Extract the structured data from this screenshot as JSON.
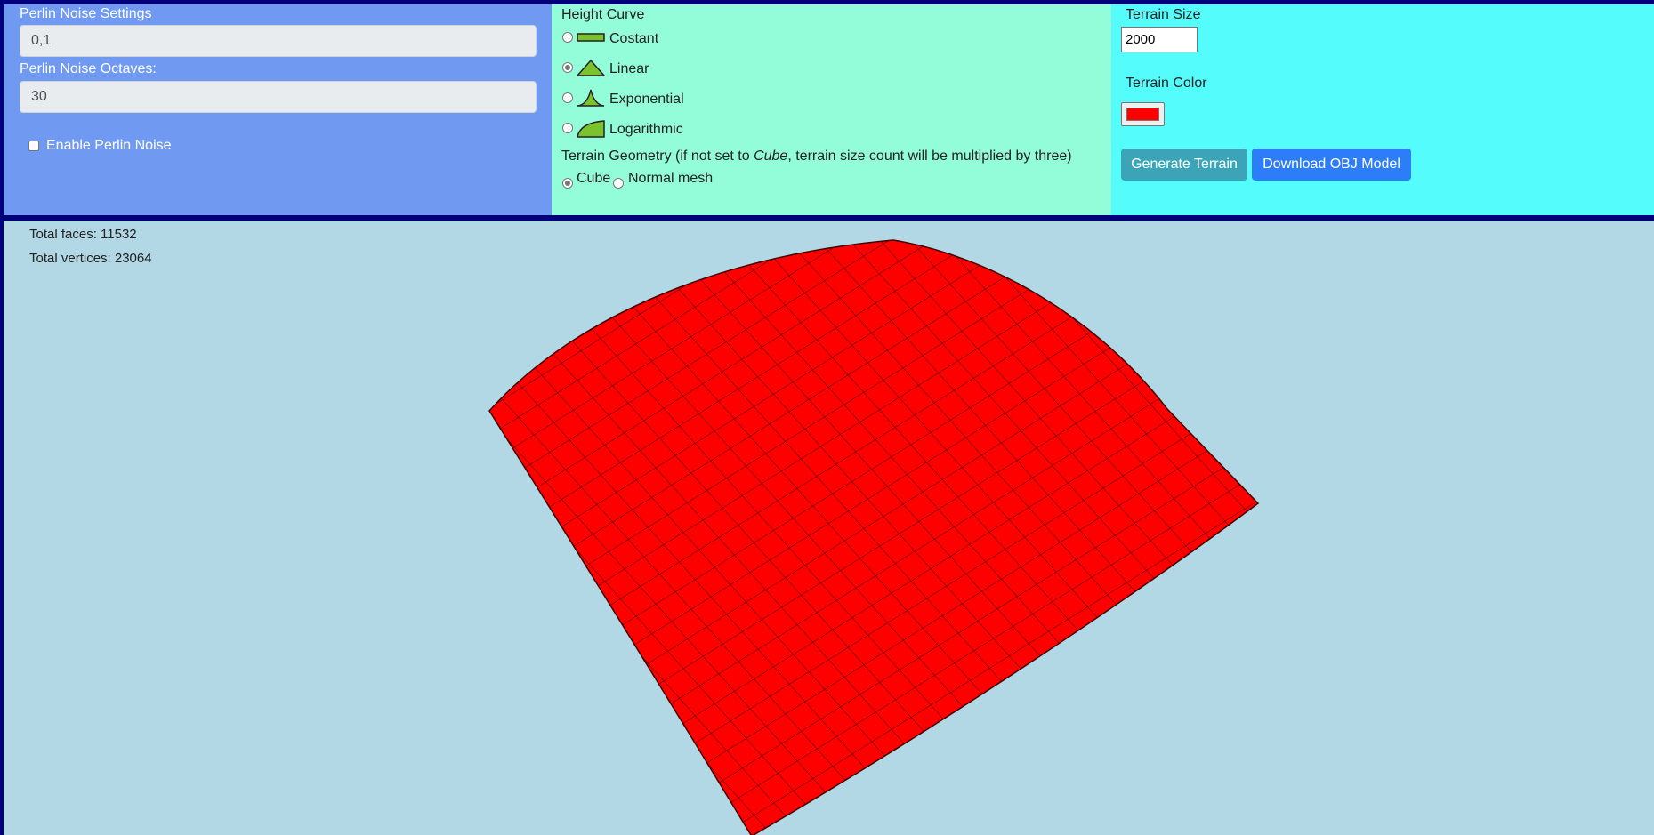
{
  "perlin": {
    "settings_label": "Perlin Noise Settings",
    "settings_value": "0,1",
    "octaves_label": "Perlin Noise Octaves:",
    "octaves_value": "30",
    "enable_label": "Enable Perlin Noise"
  },
  "height_curve": {
    "title": "Height Curve",
    "options": [
      {
        "label": "Costant",
        "selected": false,
        "icon": "constant-curve-icon"
      },
      {
        "label": "Linear",
        "selected": true,
        "icon": "linear-curve-icon"
      },
      {
        "label": "Exponential",
        "selected": false,
        "icon": "exponential-curve-icon"
      },
      {
        "label": "Logarithmic",
        "selected": false,
        "icon": "logarithmic-curve-icon"
      }
    ]
  },
  "geometry": {
    "label_pre": "Terrain Geometry (if not set to ",
    "label_em": "Cube",
    "label_post": ", terrain size count will be multiplied by three)",
    "cube_label": "Cube",
    "mesh_label": "Normal mesh"
  },
  "terrain": {
    "size_label": "Terrain Size",
    "size_value": "2000",
    "color_label": "Terrain Color",
    "color_value": "#ff0000",
    "generate_label": "Generate Terrain",
    "download_label": "Download OBJ Model"
  },
  "stats": {
    "faces": "Total faces: 11532",
    "vertices": "Total vertices: 23064"
  },
  "colors": {
    "panel1": "#7099f1",
    "panel2": "#93fcd8",
    "panel3": "#55fcfc",
    "viewport": "#b2d7e5",
    "terrain": "#ff0000",
    "border": "#00007a"
  }
}
